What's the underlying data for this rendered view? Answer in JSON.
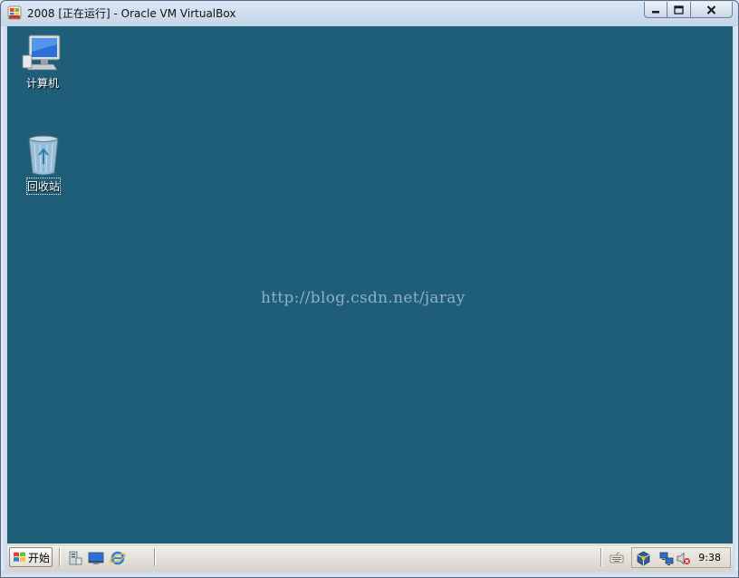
{
  "window": {
    "title": "2008 [正在运行] - Oracle VM VirtualBox",
    "app_icon": "windows-2008-icon",
    "buttons": {
      "minimize_icon": "minimize-icon",
      "maximize_icon": "maximize-icon",
      "close_icon": "close-icon"
    }
  },
  "desktop": {
    "background_color": "#1f5e79",
    "icons": [
      {
        "label": "计算机",
        "icon": "computer-icon"
      },
      {
        "label": "回收站",
        "icon": "recycle-bin-icon"
      }
    ],
    "watermark": "http://blog.csdn.net/jaray"
  },
  "taskbar": {
    "start_label": "开始",
    "quick_launch": [
      {
        "icon": "server-manager-icon"
      },
      {
        "icon": "show-desktop-icon"
      },
      {
        "icon": "internet-explorer-icon"
      }
    ],
    "tray": {
      "icons": [
        "keyboard-icon",
        "virtualbox-icon",
        "network-icon",
        "volume-muted-icon"
      ],
      "clock": "9:38"
    }
  }
}
